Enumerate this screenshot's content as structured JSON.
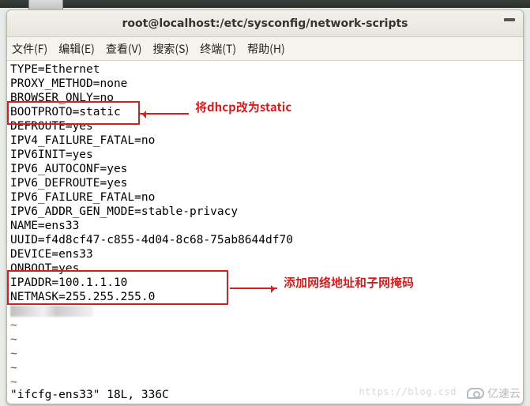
{
  "window": {
    "title": "root@localhost:/etc/sysconfig/network-scripts"
  },
  "menu": {
    "file": "文件(F)",
    "edit": "编辑(E)",
    "view": "查看(V)",
    "search": "搜索(S)",
    "terminal": "终端(T)",
    "help": "帮助(H)"
  },
  "file_lines": [
    "TYPE=Ethernet",
    "PROXY_METHOD=none",
    "BROWSER_ONLY=no",
    "BOOTPROTO=static",
    "DEFROUTE=yes",
    "IPV4_FAILURE_FATAL=no",
    "IPV6INIT=yes",
    "IPV6_AUTOCONF=yes",
    "IPV6_DEFROUTE=yes",
    "IPV6_FAILURE_FATAL=no",
    "IPV6_ADDR_GEN_MODE=stable-privacy",
    "NAME=ens33",
    "UUID=f4d8cf47-c855-4d04-8c68-75ab8644df70",
    "DEVICE=ens33",
    "ONBOOT=yes",
    "IPADDR=100.1.1.10",
    "NETMASK=255.255.255.0"
  ],
  "tilde_rows": [
    "~",
    "~",
    "~",
    "~",
    "~"
  ],
  "status_line": "\"ifcfg-ens33\" 18L, 336C",
  "annotations": {
    "note1": "将dhcp改为static",
    "note2": "添加网络地址和子网掩码"
  },
  "faded_url": "https://blog.csd",
  "watermark": "亿速云"
}
